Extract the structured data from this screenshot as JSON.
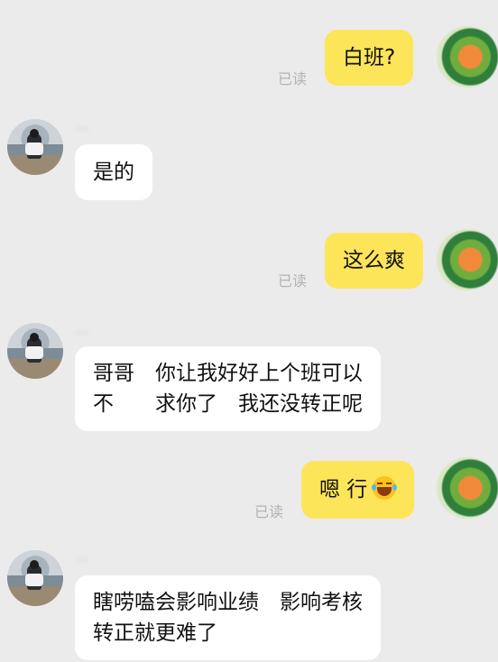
{
  "messages": [
    {
      "side": "me",
      "text": "白班?",
      "status": "已读"
    },
    {
      "side": "them",
      "sender": "...",
      "text": "是的"
    },
    {
      "side": "me",
      "text": "这么爽",
      "status": "已读"
    },
    {
      "side": "them",
      "sender": "...",
      "lines": [
        "哥哥　你让我好好上个班可以",
        "不　　求你了　我还没转正呢"
      ]
    },
    {
      "side": "me",
      "text": "嗯 行",
      "emoji": "laughing-tears-emoji",
      "status": "已读"
    },
    {
      "side": "them",
      "sender": "...",
      "lines": [
        "瞎唠嗑会影响业绩　影响考核",
        "转正就更难了"
      ]
    }
  ],
  "colors": {
    "background": "#ebebeb",
    "my_bubble": "#fde55a",
    "their_bubble": "#ffffff",
    "read_status": "#b3b3b3"
  }
}
